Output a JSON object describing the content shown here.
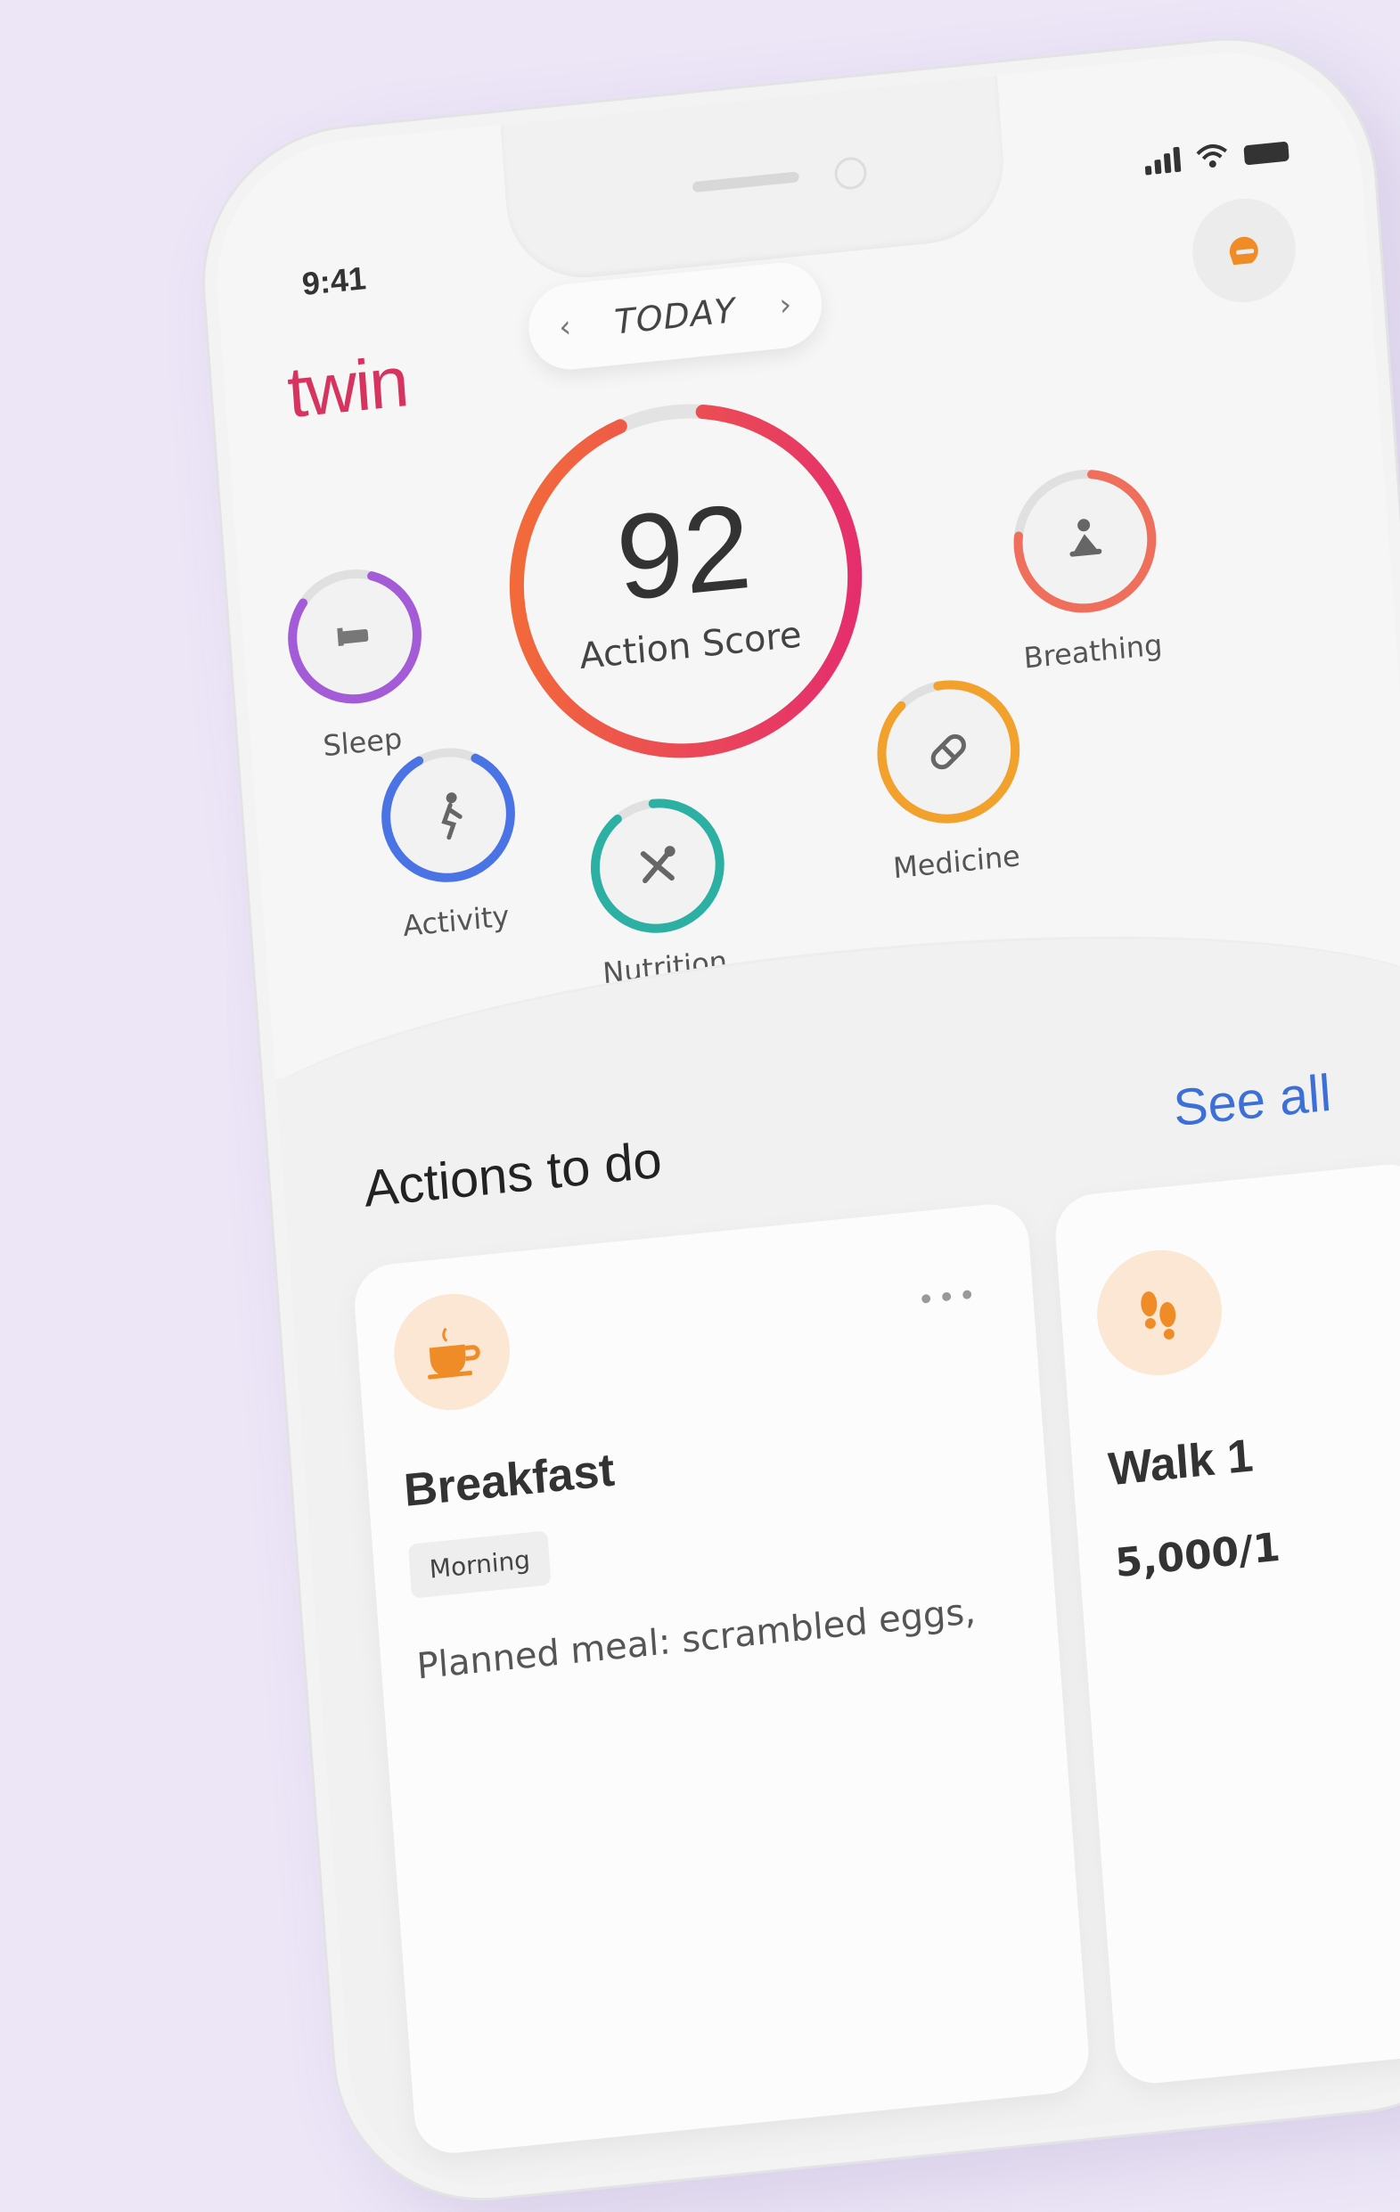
{
  "status_bar": {
    "time": "9:41"
  },
  "header": {
    "logo": "twin",
    "date_selector": {
      "label": "TODAY",
      "prev_icon": "chevron-left-icon",
      "next_icon": "chevron-right-icon"
    },
    "avatar_icon": "chat-icon"
  },
  "score": {
    "value": "92",
    "label": "Action Score",
    "progress": 0.92
  },
  "metrics": [
    {
      "label": "Sleep",
      "icon": "bed-icon",
      "progress": 0.8,
      "color": "#a35bd8"
    },
    {
      "label": "Breathing",
      "icon": "meditation-icon",
      "progress": 0.75,
      "color": "#ef6f5c"
    },
    {
      "label": "Activity",
      "icon": "running-icon",
      "progress": 0.85,
      "color": "#4a73e6"
    },
    {
      "label": "Nutrition",
      "icon": "utensils-icon",
      "progress": 0.9,
      "color": "#2bb0a3"
    },
    {
      "label": "Medicine",
      "icon": "pill-icon",
      "progress": 0.9,
      "color": "#f2a12c"
    }
  ],
  "actions": {
    "title": "Actions to do",
    "see_all": "See all",
    "cards": [
      {
        "title": "Breakfast",
        "tag": "Morning",
        "desc": "Planned meal: scrambled eggs,",
        "icon": "coffee-cup-icon"
      },
      {
        "title": "Walk 1",
        "metric": "5,000/1",
        "icon": "footprints-icon"
      }
    ]
  },
  "colors": {
    "brand": "#d6335f",
    "link": "#3c6fd8",
    "background": "#ece6f7"
  }
}
